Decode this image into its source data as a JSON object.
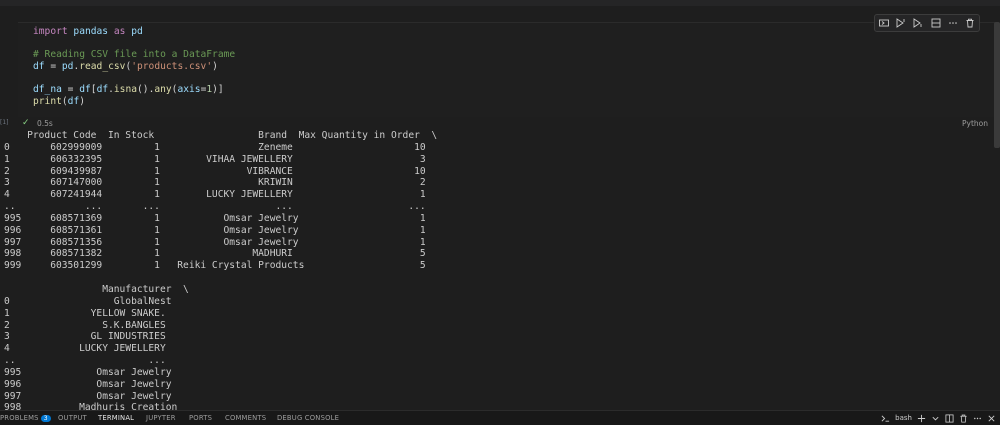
{
  "cell": {
    "code": [
      [
        {
          "t": "import",
          "c": "kw"
        },
        {
          "t": " pandas ",
          "c": "id"
        },
        {
          "t": "as",
          "c": "kw"
        },
        {
          "t": " pd",
          "c": "id"
        }
      ],
      [],
      [
        {
          "t": "# Reading CSV file into a DataFrame",
          "c": "cm"
        }
      ],
      [
        {
          "t": "df",
          "c": "id"
        },
        {
          "t": " = ",
          "c": "pl"
        },
        {
          "t": "pd",
          "c": "id"
        },
        {
          "t": ".",
          "c": "pl"
        },
        {
          "t": "read_csv",
          "c": "fn"
        },
        {
          "t": "(",
          "c": "pl"
        },
        {
          "t": "'products.csv'",
          "c": "str"
        },
        {
          "t": ")",
          "c": "pl"
        }
      ],
      [],
      [
        {
          "t": "df_na",
          "c": "id"
        },
        {
          "t": " = ",
          "c": "pl"
        },
        {
          "t": "df",
          "c": "id"
        },
        {
          "t": "[",
          "c": "pl"
        },
        {
          "t": "df",
          "c": "id"
        },
        {
          "t": ".",
          "c": "pl"
        },
        {
          "t": "isna",
          "c": "fn"
        },
        {
          "t": "().",
          "c": "pl"
        },
        {
          "t": "any",
          "c": "fn"
        },
        {
          "t": "(",
          "c": "pl"
        },
        {
          "t": "axis",
          "c": "id"
        },
        {
          "t": "=",
          "c": "pl"
        },
        {
          "t": "1",
          "c": "num"
        },
        {
          "t": ")]",
          "c": "pl"
        }
      ],
      [
        {
          "t": "print",
          "c": "fn"
        },
        {
          "t": "(",
          "c": "pl"
        },
        {
          "t": "df",
          "c": "id"
        },
        {
          "t": ")",
          "c": "pl"
        }
      ]
    ],
    "status_check": "✓",
    "duration": "0.5s",
    "language": "Python",
    "line_marker": "[1]"
  },
  "toolbar": {
    "icons": [
      "run-by-line-icon",
      "execute-above-icon",
      "execute-below-icon",
      "split-cell-icon",
      "more-actions-icon",
      "delete-cell-icon"
    ]
  },
  "output": {
    "text": "    Product Code  In Stock                  Brand  Max Quantity in Order  \\\n0       602999009         1                 Zeneme                     10   \n1       606332395         1        VIHAA JEWELLERY                      3   \n2       609439987         1               VIBRANCE                     10   \n3       607147000         1                 KRIWIN                      2   \n4       607241944         1        LUCKY JEWELLERY                      1   \n..            ...       ...                    ...                    ...   \n995     608571369         1           Omsar Jewelry                     1   \n996     608571361         1           Omsar Jewelry                     1   \n997     608571356         1           Omsar Jewelry                     1   \n998     608571382         1                MADHURI                      5   \n999     603501299         1   Reiki Crystal Products                    5   \n\n                 Manufacturer  \\\n0                  GlobalNest   \n1              YELLOW SNAKE.   \n2                S.K.BANGLES   \n3              GL INDUSTRIES   \n4            LUCKY JEWELLERY   \n..                       ...   \n995             Omsar Jewelry   \n996             Omsar Jewelry   \n997             Omsar Jewelry   \n998          Madhuris Creation   "
  },
  "panel": {
    "tabs": [
      {
        "label": "PROBLEMS",
        "name": "tab-problems"
      },
      {
        "label": "OUTPUT",
        "name": "tab-output"
      },
      {
        "label": "TERMINAL",
        "name": "tab-terminal"
      },
      {
        "label": "JUPYTER",
        "name": "tab-jupyter"
      },
      {
        "label": "PORTS",
        "name": "tab-ports"
      },
      {
        "label": "COMMENTS",
        "name": "tab-comments"
      },
      {
        "label": "DEBUG CONSOLE",
        "name": "tab-debug-console"
      }
    ],
    "active_tab": "TERMINAL",
    "problems_count": "3",
    "terminal_label": "bash"
  },
  "colors": {
    "background": "#1e1e1e",
    "accent": "#0078d4",
    "success": "#89d185"
  }
}
